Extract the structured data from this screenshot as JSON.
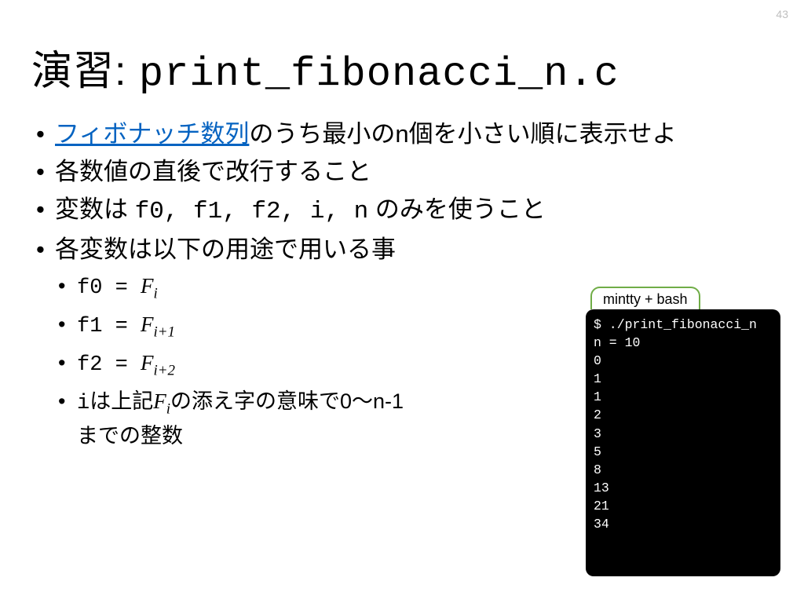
{
  "page_number": "43",
  "title_prefix": "演習: ",
  "title_filename": "print_fibonacci_n.c",
  "bullets": {
    "b1_link": "フィボナッチ数列",
    "b1_rest": "のうち最小のn個を小さい順に表示せよ",
    "b2": "各数値の直後で改行すること",
    "b3_pre": "変数は ",
    "b3_vars": "f0, f1, f2, i, n",
    "b3_post": " のみを使うこと",
    "b4": "各変数は以下の用途で用いる事"
  },
  "sub": {
    "s1_pre": "f0 = ",
    "s1_F": "F",
    "s1_sub": "i",
    "s2_pre": "f1 = ",
    "s2_F": "F",
    "s2_sub": "i+1",
    "s3_pre": "f2 = ",
    "s3_F": "F",
    "s3_sub": "i+2",
    "s4_pre": "iは上記",
    "s4_F": "F",
    "s4_sub": "i",
    "s4_post": "の添え字の意味で0～n-1までの整数"
  },
  "terminal": {
    "label": "mintty + bash",
    "content": "$ ./print_fibonacci_n\nn = 10\n0\n1\n1\n2\n3\n5\n8\n13\n21\n34"
  }
}
